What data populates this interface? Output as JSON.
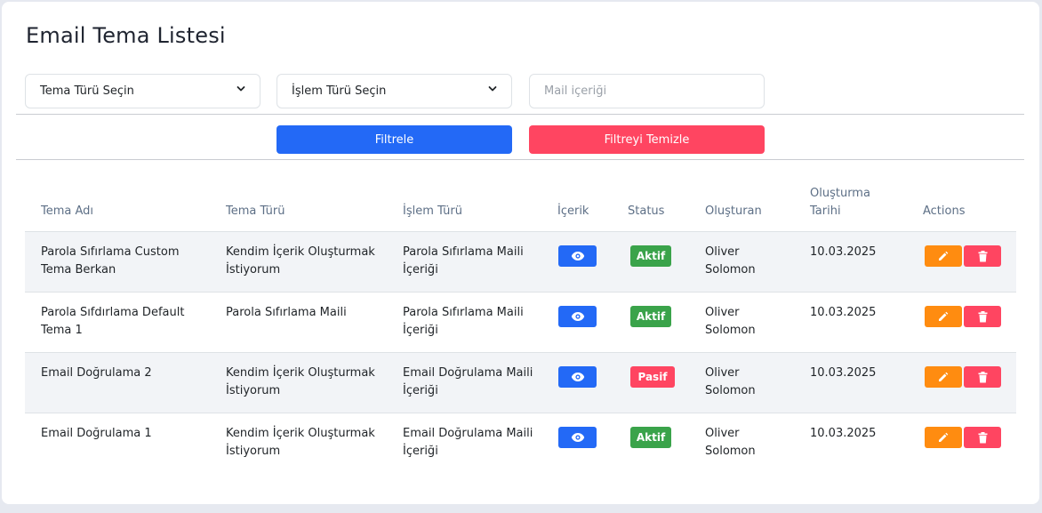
{
  "page": {
    "title": "Email Tema Listesi"
  },
  "filters": {
    "tema_turu_placeholder": "Tema Türü Seçin",
    "islem_turu_placeholder": "İşlem Türü Seçin",
    "mail_icerigi_placeholder": "Mail içeriği",
    "filter_button": "Filtrele",
    "clear_button": "Filtreyi Temizle"
  },
  "table": {
    "headers": {
      "tema_adi": "Tema Adı",
      "tema_turu": "Tema Türü",
      "islem_turu": "İşlem Türü",
      "icerik": "İçerik",
      "status": "Status",
      "olusturan": "Oluşturan",
      "olusturma_tarihi": "Oluşturma Tarihi",
      "actions": "Actions"
    },
    "rows": [
      {
        "tema_adi": "Parola Sıfırlama Custom Tema Berkan",
        "tema_turu": "Kendim İçerik Oluşturmak İstiyorum",
        "islem_turu": "Parola Sıfırlama Maili İçeriği",
        "status": "Aktif",
        "olusturan": "Oliver Solomon",
        "tarih": "10.03.2025"
      },
      {
        "tema_adi": "Parola Sıfdırlama Default Tema 1",
        "tema_turu": "Parola Sıfırlama Maili",
        "islem_turu": "Parola Sıfırlama Maili İçeriği",
        "status": "Aktif",
        "olusturan": "Oliver Solomon",
        "tarih": "10.03.2025"
      },
      {
        "tema_adi": "Email Doğrulama 2",
        "tema_turu": "Kendim İçerik Oluşturmak İstiyorum",
        "islem_turu": "Email Doğrulama Maili İçeriği",
        "status": "Pasif",
        "olusturan": "Oliver Solomon",
        "tarih": "10.03.2025"
      },
      {
        "tema_adi": "Email Doğrulama 1",
        "tema_turu": "Kendim İçerik Oluşturmak İstiyorum",
        "islem_turu": "Email Doğrulama Maili İçeriği",
        "status": "Aktif",
        "olusturan": "Oliver Solomon",
        "tarih": "10.03.2025"
      }
    ]
  },
  "icons": {
    "select_chevron": "chevron-down-icon",
    "view": "eye-icon",
    "edit": "pencil-icon",
    "delete": "trash-icon"
  },
  "colors": {
    "primary": "#2369f6",
    "danger": "#ff4561",
    "success": "#3aa34a",
    "warning": "#ff8c10"
  }
}
